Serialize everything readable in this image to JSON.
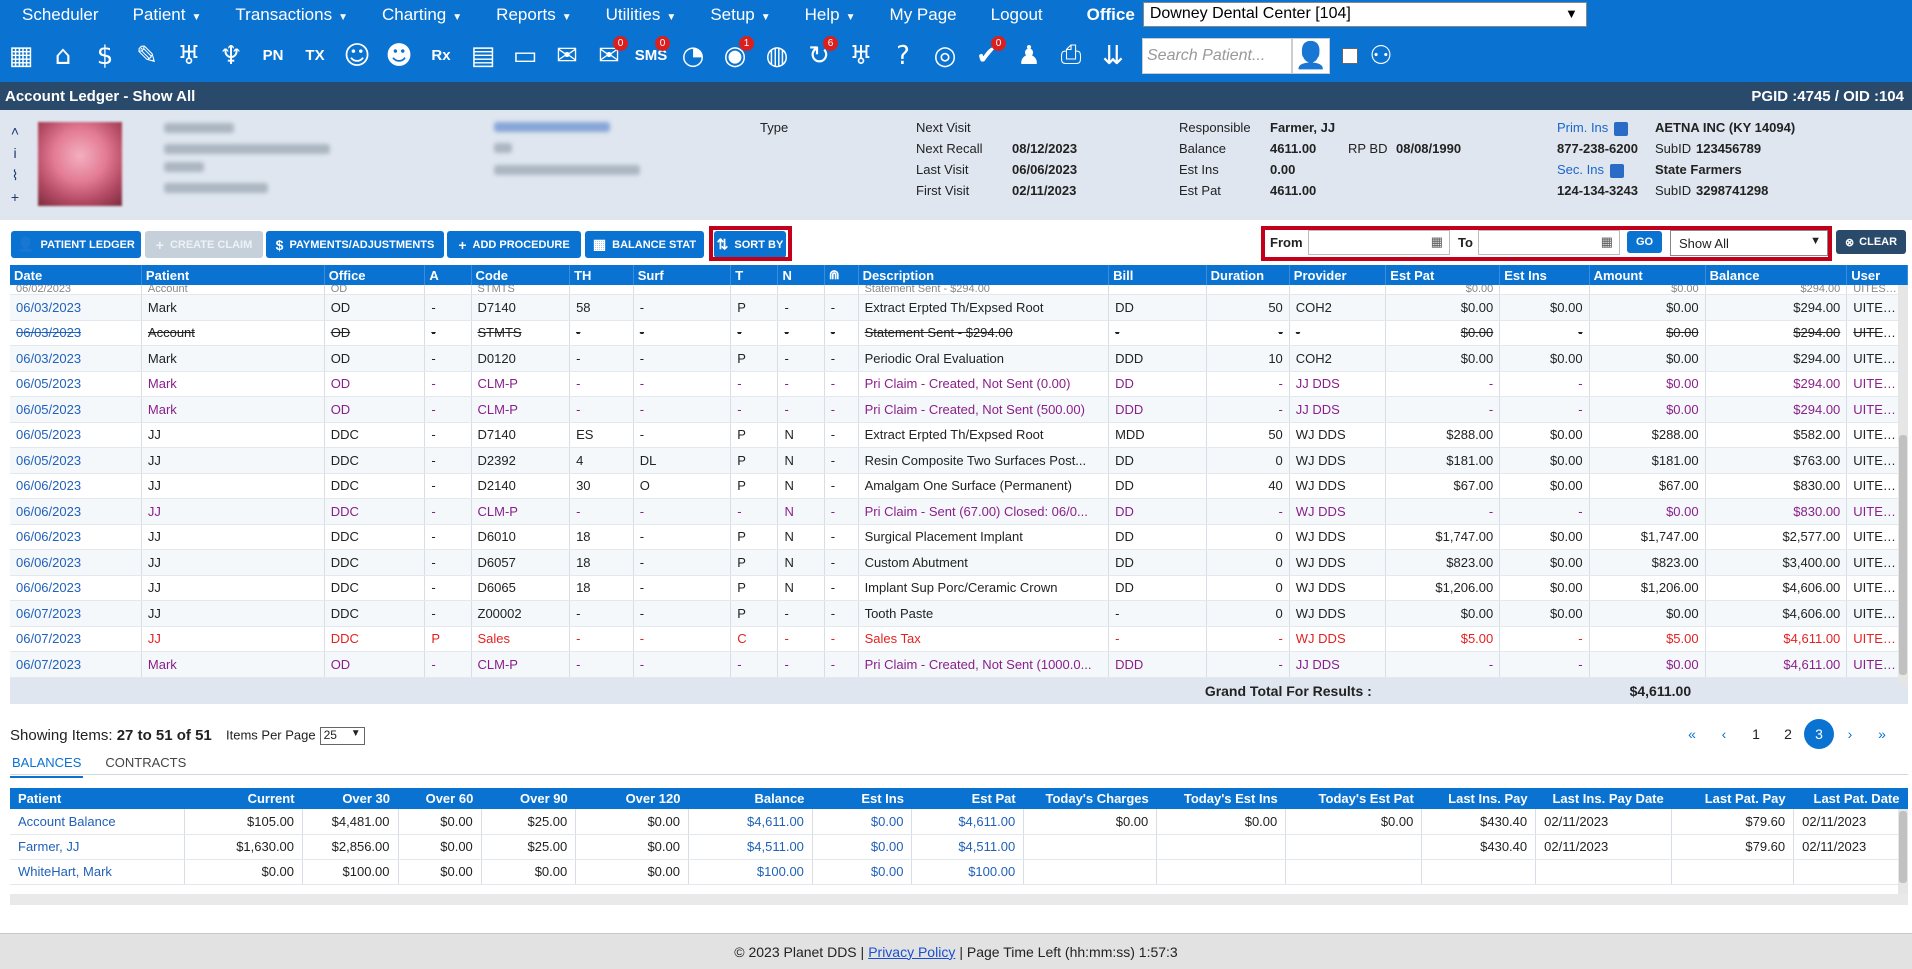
{
  "menu": {
    "items": [
      {
        "label": "Scheduler",
        "caret": false
      },
      {
        "label": "Patient",
        "caret": true
      },
      {
        "label": "Transactions",
        "caret": true
      },
      {
        "label": "Charting",
        "caret": true
      },
      {
        "label": "Reports",
        "caret": true
      },
      {
        "label": "Utilities",
        "caret": true
      },
      {
        "label": "Setup",
        "caret": true
      },
      {
        "label": "Help",
        "caret": true
      },
      {
        "label": "My Page",
        "caret": false
      },
      {
        "label": "Logout",
        "caret": false
      }
    ],
    "office_label": "Office",
    "office_value": "Downey Dental Center [104]"
  },
  "iconbar": {
    "icons": [
      {
        "name": "calendar-icon",
        "glyph": "▦"
      },
      {
        "name": "home-icon",
        "glyph": "⌂"
      },
      {
        "name": "dollar-icon",
        "glyph": "$"
      },
      {
        "name": "pencil-icon",
        "glyph": "✎"
      },
      {
        "name": "tooth-icon",
        "glyph": "♅"
      },
      {
        "name": "dentures-icon",
        "glyph": "♆"
      },
      {
        "name": "pn-icon",
        "text": "PN"
      },
      {
        "name": "tx-icon",
        "text": "TX"
      },
      {
        "name": "add-patient-icon",
        "glyph": "☺"
      },
      {
        "name": "add-family-icon",
        "glyph": "☻"
      },
      {
        "name": "rx-icon",
        "text": "Rx"
      },
      {
        "name": "notes-icon",
        "glyph": "▤"
      },
      {
        "name": "document-icon",
        "glyph": "▭"
      },
      {
        "name": "mail-icon",
        "glyph": "✉"
      },
      {
        "name": "message-icon",
        "glyph": "✉",
        "badge": "0"
      },
      {
        "name": "sms-icon",
        "text": "SMS",
        "badge": "0"
      },
      {
        "name": "clock-icon",
        "glyph": "◔"
      },
      {
        "name": "world-user-icon",
        "glyph": "◉",
        "badge": "1"
      },
      {
        "name": "globe-user-icon",
        "glyph": "◍"
      },
      {
        "name": "refresh-user-icon",
        "glyph": "↻",
        "badge": "6"
      },
      {
        "name": "tooth-outline-icon",
        "glyph": "♅"
      },
      {
        "name": "tooth-help-icon",
        "glyph": "?"
      },
      {
        "name": "globe-icon",
        "glyph": "◎"
      },
      {
        "name": "doc-check-icon",
        "glyph": "✔",
        "badge": "0"
      },
      {
        "name": "people-icon",
        "glyph": "♟"
      },
      {
        "name": "printer-icon",
        "glyph": "⎙"
      },
      {
        "name": "collapse-icon",
        "glyph": "⇊"
      }
    ],
    "search_placeholder": "Search Patient..."
  },
  "title": {
    "text": "Account Ledger - Show All",
    "ids": "PGID :4745  /  OID :104"
  },
  "patient": {
    "type_label": "Type",
    "next_visit_label": "Next Visit",
    "next_visit": "",
    "next_recall_label": "Next Recall",
    "next_recall": "08/12/2023",
    "last_visit_label": "Last Visit",
    "last_visit": "06/06/2023",
    "first_visit_label": "First Visit",
    "first_visit": "02/11/2023",
    "responsible_label": "Responsible",
    "responsible": "Farmer, JJ",
    "balance_label": "Balance",
    "balance": "4611.00",
    "rpbd_label": "RP BD",
    "rpbd": "08/08/1990",
    "est_ins_label": "Est Ins",
    "est_ins": "0.00",
    "est_pat_label": "Est Pat",
    "est_pat": "4611.00",
    "prim_ins_label": "Prim. Ins",
    "prim_ins": "AETNA INC (KY 14094)",
    "prim_phone": "877-238-6200",
    "prim_subid_label": "SubID",
    "prim_subid": "123456789",
    "sec_ins_label": "Sec. Ins",
    "sec_ins": "State Farmers",
    "sec_phone": "124-134-3243",
    "sec_subid_label": "SubID",
    "sec_subid": "3298741298"
  },
  "toolbar": {
    "patient_ledger": "PATIENT LEDGER",
    "create_claim": "CREATE CLAIM",
    "payments": "PAYMENTS/ADJUSTMENTS",
    "add_procedure": "ADD PROCEDURE",
    "balance_stat": "BALANCE STAT",
    "sort_by": "SORT BY",
    "from_label": "From",
    "to_label": "To",
    "go": "GO",
    "show_all": "Show All",
    "clear": "CLEAR"
  },
  "ledger": {
    "columns": [
      "Date",
      "Patient",
      "Office",
      "A",
      "Code",
      "TH",
      "Surf",
      "T",
      "N",
      "⋒",
      "Description",
      "Bill",
      "Duration",
      "Provider",
      "Est Pat",
      "Est Ins",
      "Amount",
      "Balance",
      "User"
    ],
    "partial_row": [
      "06/02/2023",
      "Account",
      "OD",
      "",
      "STMTS",
      "",
      "",
      "",
      "",
      "",
      "Statement Sent - $294.00",
      "",
      "",
      "",
      "$0.00",
      "",
      "$0.00",
      "$294.00",
      "UITESTING"
    ],
    "rows": [
      {
        "style": "",
        "cells": [
          "06/03/2023",
          "Mark",
          "OD",
          "-",
          "D7140",
          "58",
          "-",
          "P",
          "-",
          "-",
          "Extract Erpted Th/Expsed Root",
          "DD",
          "50",
          "COH2",
          "$0.00",
          "$0.00",
          "$0.00",
          "$294.00",
          "UITESTING"
        ]
      },
      {
        "style": "strike",
        "cells": [
          "06/03/2023",
          "Account",
          "OD",
          "-",
          "STMTS",
          "-",
          "-",
          "-",
          "-",
          "-",
          "Statement Sent - $294.00",
          "-",
          "-",
          "-",
          "$0.00",
          "-",
          "$0.00",
          "$294.00",
          "UITESTING"
        ]
      },
      {
        "style": "",
        "cells": [
          "06/03/2023",
          "Mark",
          "OD",
          "-",
          "D0120",
          "-",
          "-",
          "P",
          "-",
          "-",
          "Periodic Oral Evaluation",
          "DDD",
          "10",
          "COH2",
          "$0.00",
          "$0.00",
          "$0.00",
          "$294.00",
          "UITESTING"
        ]
      },
      {
        "style": "purple",
        "cells": [
          "06/05/2023",
          "Mark",
          "OD",
          "-",
          "CLM-P",
          "-",
          "-",
          "-",
          "-",
          "-",
          "Pri Claim - Created, Not Sent (0.00)",
          "DD",
          "-",
          "JJ DDS",
          "-",
          "-",
          "$0.00",
          "$294.00",
          "UITESTING"
        ]
      },
      {
        "style": "purple",
        "cells": [
          "06/05/2023",
          "Mark",
          "OD",
          "-",
          "CLM-P",
          "-",
          "-",
          "-",
          "-",
          "-",
          "Pri Claim - Created, Not Sent (500.00)",
          "DDD",
          "-",
          "JJ DDS",
          "-",
          "-",
          "$0.00",
          "$294.00",
          "UITESTING"
        ]
      },
      {
        "style": "",
        "cells": [
          "06/05/2023",
          "JJ",
          "DDC",
          "-",
          "D7140",
          "ES",
          "-",
          "P",
          "N",
          "-",
          "Extract Erpted Th/Expsed Root",
          "MDD",
          "50",
          "WJ DDS",
          "$288.00",
          "$0.00",
          "$288.00",
          "$582.00",
          "UITESTING"
        ]
      },
      {
        "style": "",
        "cells": [
          "06/05/2023",
          "JJ",
          "DDC",
          "-",
          "D2392",
          "4",
          "DL",
          "P",
          "N",
          "-",
          "Resin Composite Two Surfaces Post...",
          "DD",
          "0",
          "WJ DDS",
          "$181.00",
          "$0.00",
          "$181.00",
          "$763.00",
          "UITESTING"
        ]
      },
      {
        "style": "",
        "cells": [
          "06/06/2023",
          "JJ",
          "DDC",
          "-",
          "D2140",
          "30",
          "O",
          "P",
          "N",
          "-",
          "Amalgam One Surface (Permanent)",
          "DD",
          "40",
          "WJ DDS",
          "$67.00",
          "$0.00",
          "$67.00",
          "$830.00",
          "UITESTING"
        ]
      },
      {
        "style": "purple",
        "cells": [
          "06/06/2023",
          "JJ",
          "DDC",
          "-",
          "CLM-P",
          "-",
          "-",
          "-",
          "N",
          "-",
          "Pri Claim - Sent (67.00) Closed: 06/0...",
          "DD",
          "-",
          "WJ DDS",
          "-",
          "-",
          "$0.00",
          "$830.00",
          "UITESTING"
        ]
      },
      {
        "style": "",
        "cells": [
          "06/06/2023",
          "JJ",
          "DDC",
          "-",
          "D6010",
          "18",
          "-",
          "P",
          "N",
          "-",
          "Surgical Placement Implant",
          "DD",
          "0",
          "WJ DDS",
          "$1,747.00",
          "$0.00",
          "$1,747.00",
          "$2,577.00",
          "UITESTING"
        ]
      },
      {
        "style": "",
        "cells": [
          "06/06/2023",
          "JJ",
          "DDC",
          "-",
          "D6057",
          "18",
          "-",
          "P",
          "N",
          "-",
          "Custom Abutment",
          "DD",
          "0",
          "WJ DDS",
          "$823.00",
          "$0.00",
          "$823.00",
          "$3,400.00",
          "UITESTING"
        ]
      },
      {
        "style": "",
        "cells": [
          "06/06/2023",
          "JJ",
          "DDC",
          "-",
          "D6065",
          "18",
          "-",
          "P",
          "N",
          "-",
          "Implant Sup Porc/Ceramic Crown",
          "DD",
          "0",
          "WJ DDS",
          "$1,206.00",
          "$0.00",
          "$1,206.00",
          "$4,606.00",
          "UITESTING"
        ]
      },
      {
        "style": "",
        "cells": [
          "06/07/2023",
          "JJ",
          "DDC",
          "-",
          "Z00002",
          "-",
          "-",
          "P",
          "-",
          "-",
          "Tooth Paste",
          "-",
          "0",
          "WJ DDS",
          "$0.00",
          "$0.00",
          "$0.00",
          "$4,606.00",
          "UITESTING"
        ]
      },
      {
        "style": "red",
        "cells": [
          "06/07/2023",
          "JJ",
          "DDC",
          "P",
          "Sales",
          "-",
          "-",
          "C",
          "-",
          "-",
          "Sales Tax",
          "-",
          "-",
          "WJ DDS",
          "$5.00",
          "-",
          "$5.00",
          "$4,611.00",
          "UITESTING"
        ]
      },
      {
        "style": "purple",
        "cells": [
          "06/07/2023",
          "Mark",
          "OD",
          "-",
          "CLM-P",
          "-",
          "-",
          "-",
          "-",
          "-",
          "Pri Claim - Created, Not Sent (1000.0...",
          "DDD",
          "-",
          "JJ DDS",
          "-",
          "-",
          "$0.00",
          "$4,611.00",
          "UITESTING"
        ]
      }
    ],
    "grand_total_label": "Grand Total For Results :",
    "grand_total": "$4,611.00"
  },
  "pagination": {
    "showing_label": "Showing Items:",
    "showing": "27 to 51 of 51",
    "items_per_page_label": "Items Per Page",
    "items_per_page": "25",
    "first": "«",
    "prev": "‹",
    "pages": [
      "1",
      "2",
      "3"
    ],
    "active_page": "3",
    "next": "›",
    "last": "»"
  },
  "tabs": [
    "BALANCES",
    "CONTRACTS"
  ],
  "balances": {
    "columns": [
      "Patient",
      "Current",
      "Over 30",
      "Over 60",
      "Over 90",
      "Over 120",
      "Balance",
      "Est Ins",
      "Est Pat",
      "Today's Charges",
      "Today's Est Ins",
      "Today's Est Pat",
      "Last Ins. Pay",
      "Last Ins. Pay Date",
      "Last Pat. Pay",
      "Last Pat. Date"
    ],
    "rows": [
      [
        "Account Balance",
        "$105.00",
        "$4,481.00",
        "$0.00",
        "$25.00",
        "$0.00",
        "$4,611.00",
        "$0.00",
        "$4,611.00",
        "$0.00",
        "$0.00",
        "$0.00",
        "$430.40",
        "02/11/2023",
        "$79.60",
        "02/11/2023"
      ],
      [
        "Farmer, JJ",
        "$1,630.00",
        "$2,856.00",
        "$0.00",
        "$25.00",
        "$0.00",
        "$4,511.00",
        "$0.00",
        "$4,511.00",
        "",
        "",
        "",
        "$430.40",
        "02/11/2023",
        "$79.60",
        "02/11/2023"
      ],
      [
        "WhiteHart, Mark",
        "$0.00",
        "$100.00",
        "$0.00",
        "$0.00",
        "$0.00",
        "$100.00",
        "$0.00",
        "$100.00",
        "",
        "",
        "",
        "",
        "",
        "",
        ""
      ]
    ]
  },
  "footer": {
    "copyright": "© 2023 Planet DDS |",
    "privacy": "Privacy Policy",
    "time_left": "|  Page Time Left (hh:mm:ss) 1:57:3"
  }
}
